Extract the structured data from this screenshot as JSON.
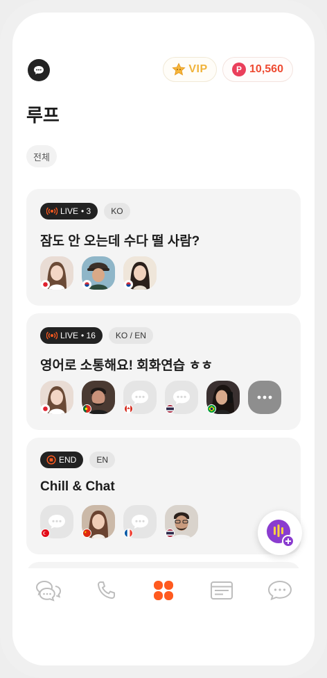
{
  "header": {
    "vip_label": "VIP",
    "coin_badge": "P",
    "coin_amount": "10,560",
    "page_title": "루프",
    "filter_label": "전체"
  },
  "colors": {
    "accent": "#ff5a1f",
    "vip_gold": "#f0b33a",
    "coin_red": "#ea3f5a",
    "fab_purple": "#8a3ccf"
  },
  "rooms": [
    {
      "status_label": "LIVE",
      "count": "• 3",
      "lang": "KO",
      "title": "잠도 안 오는데 수다 떨 사람?",
      "members": [
        "jp",
        "kr",
        "kr"
      ]
    },
    {
      "status_label": "LIVE",
      "count": "• 16",
      "lang": "KO / EN",
      "title": "영어로 소통해요! 회화연습 ㅎㅎ",
      "members": [
        "jp",
        "pt",
        "ca",
        "th",
        "br",
        "more"
      ]
    },
    {
      "status_label": "END",
      "count": "",
      "lang": "EN",
      "title": "Chill & Chat",
      "members": [
        "tr",
        "cn",
        "fr",
        "th"
      ]
    }
  ],
  "nav": [
    "group-chat-icon",
    "phone-icon",
    "loop-icon",
    "news-icon",
    "messages-icon"
  ]
}
